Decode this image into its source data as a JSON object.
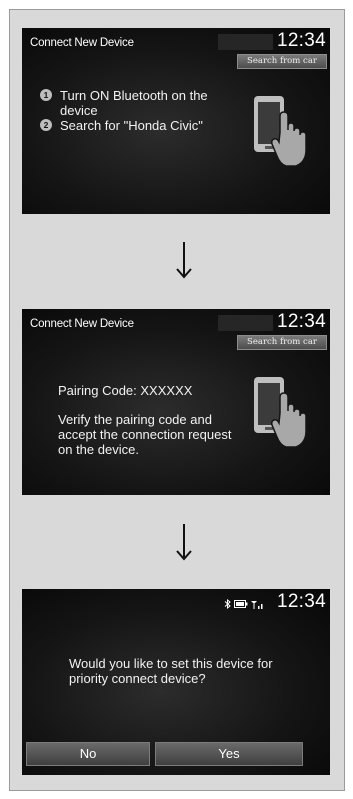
{
  "screen1": {
    "title": "Connect New Device",
    "clock": "12:34",
    "search_button": "Search from car",
    "steps": [
      {
        "num": "1",
        "text": "Turn ON Bluetooth on the device"
      },
      {
        "num": "2",
        "text": "Search for \"Honda Civic\""
      }
    ]
  },
  "screen2": {
    "title": "Connect New Device",
    "clock": "12:34",
    "search_button": "Search from car",
    "pairing_code": "Pairing Code: XXXXXX",
    "instructions": "Verify the pairing code and accept the connection request on the device."
  },
  "screen3": {
    "clock": "12:34",
    "question": "Would you like to set this device for priority connect device?",
    "no_label": "No",
    "yes_label": "Yes",
    "status_icons": [
      "bluetooth-icon",
      "battery-icon",
      "signal-icon"
    ]
  },
  "colors": {
    "screen_bg": "#151515",
    "panel_bg": "#d9d9d9",
    "button_bg": "#5a5a5a"
  }
}
